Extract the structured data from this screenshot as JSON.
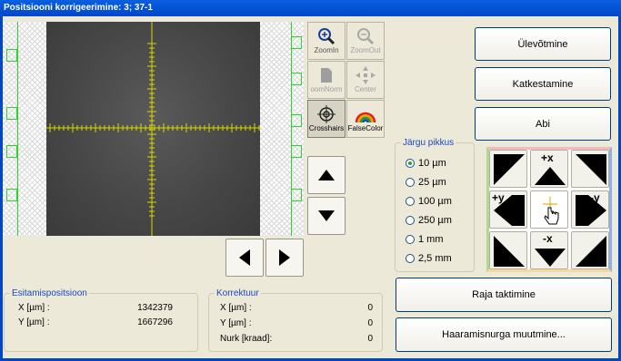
{
  "window": {
    "title": "Positsiooni korrigeerimine: 3; 37-1"
  },
  "tools": {
    "zoomin": "ZoomIn",
    "zoomout": "ZoomOut",
    "zoomnormal": "oomNorm",
    "center": "Center",
    "crosshairs": "Crosshairs",
    "falsecolor": "FalseColor"
  },
  "step": {
    "legend": "Järgu pikkus",
    "options": [
      "10 µm",
      "25 µm",
      "100 µm",
      "250 µm",
      "1 mm",
      "2,5 mm"
    ],
    "selected": "10 µm"
  },
  "jog": {
    "plus_x": "+x",
    "minus_x": "-x",
    "plus_y": "+y",
    "minus_y": "-y"
  },
  "buttons": {
    "accept": "Ülevõtmine",
    "cancel": "Katkestamine",
    "help": "Abi",
    "raja": "Raja taktimine",
    "haaramis": "Haaramisnurga muutmine..."
  },
  "display_position": {
    "legend": "Esitamispositsioon",
    "x_label": "X [µm] :",
    "x_value": "1342379",
    "y_label": "Y [µm] :",
    "y_value": "1667296"
  },
  "correction": {
    "legend": "Korrektuur",
    "x_label": "X [µm] :",
    "x_value": "0",
    "y_label": "Y [µm] :",
    "y_value": "0",
    "nurk_label": "Nurk [kraad]:",
    "nurk_value": "0"
  },
  "colors": {
    "crosshair": "#d8d800",
    "titlebar": "#0a5fe0",
    "group_legend": "#1a47c5"
  }
}
